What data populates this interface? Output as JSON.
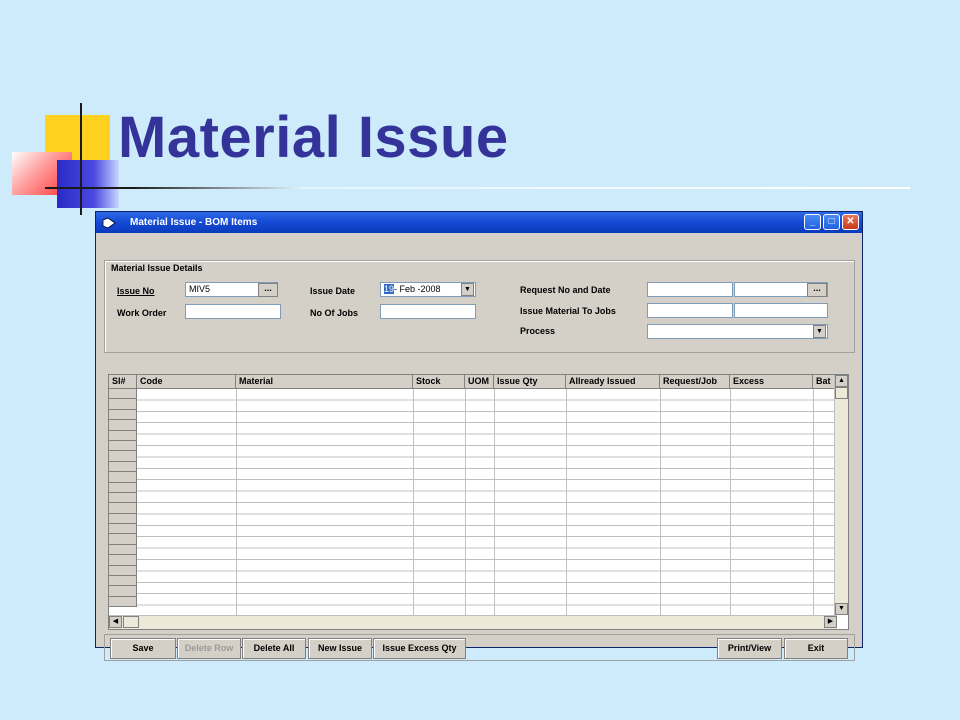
{
  "slide": {
    "title": "Material Issue"
  },
  "window": {
    "title": "Material Issue - BOM Items",
    "controls": {
      "minimize": "_",
      "maximize": "□",
      "close": "✕"
    }
  },
  "details": {
    "group_label": "Material Issue Details",
    "issue_no": {
      "label": "Issue No",
      "value": "MIV5"
    },
    "work_order": {
      "label": "Work Order",
      "value": ""
    },
    "issue_date": {
      "label": "Issue Date",
      "day": "19",
      "rest": "- Feb -2008"
    },
    "no_of_jobs": {
      "label": "No Of Jobs",
      "value": ""
    },
    "request_no_date": {
      "label": "Request No and Date",
      "value1": "",
      "value2": ""
    },
    "issue_material_to_jobs": {
      "label": "Issue Material To Jobs",
      "value1": "",
      "value2": ""
    },
    "process": {
      "label": "Process",
      "value": ""
    },
    "ellipsis": "..."
  },
  "grid": {
    "columns": [
      "Sl#",
      "Code",
      "Material",
      "Stock",
      "UOM",
      "Issue Qty",
      "Allready Issued",
      "Request/Job",
      "Excess",
      "Bat"
    ]
  },
  "buttons": {
    "save": "Save",
    "delete_row": "Delete Row",
    "delete_all": "Delete All",
    "new_issue": "New Issue",
    "issue_excess_qty": "Issue Excess Qty",
    "print_view": "Print/View",
    "exit": "Exit"
  },
  "icons": [
    "app-icon",
    "minimize-icon",
    "maximize-icon",
    "close-icon",
    "ellipsis-icon",
    "dropdown-arrow-icon",
    "scroll-up-icon",
    "scroll-down-icon",
    "scroll-left-icon",
    "scroll-right-icon"
  ]
}
